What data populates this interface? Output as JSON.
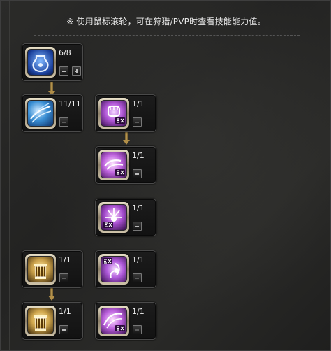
{
  "hint": "※ 使用鼠标滚轮，可在狩猎/PVP时查看技能能力值。",
  "colors": {
    "accent_gold": "#c9a45a",
    "ex_purple": "#b35ad9",
    "ice_blue": "#3a8fd4"
  },
  "skills": [
    {
      "id": "potion",
      "icon": "potion-bag-icon",
      "level": "6/8"
    },
    {
      "id": "frost",
      "icon": "frost-burst-icon",
      "level": "11/11"
    },
    {
      "id": "ex-punch",
      "icon": "ex-fist-icon",
      "level": "1/1"
    },
    {
      "id": "ex-charge",
      "icon": "ex-charge-icon",
      "level": "1/1"
    },
    {
      "id": "ex-burst",
      "icon": "ex-burst-icon",
      "level": "1/1"
    },
    {
      "id": "pillar",
      "icon": "golden-pillar-icon",
      "level": "1/1"
    },
    {
      "id": "ex-spirit",
      "icon": "ex-spirit-icon",
      "level": "1/1"
    },
    {
      "id": "pillar-2",
      "icon": "golden-pillar-icon",
      "level": "1/1"
    },
    {
      "id": "ex-sweep",
      "icon": "ex-sweep-icon",
      "level": "1/1"
    }
  ]
}
